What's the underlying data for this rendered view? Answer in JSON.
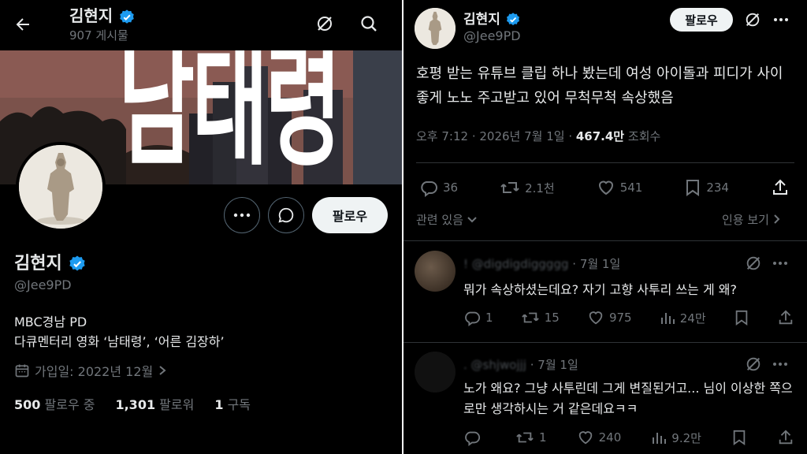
{
  "colors": {
    "background": "#000000",
    "text": "#e7e9ea",
    "muted": "#71767b",
    "verified": "#1d9bf0",
    "follow_button": "#eff3f4"
  },
  "left": {
    "header": {
      "name": "김현지",
      "posts": "907 게시물"
    },
    "banner": {
      "title": "남태령"
    },
    "profile": {
      "name": "김현지",
      "handle": "@Jee9PD",
      "bio_line1": "MBC경남 PD",
      "bio_line2": "다큐멘터리 영화 ‘남태령’, ‘어른 김장하’",
      "joined": "가입일: 2022년 12월",
      "following_count": "500",
      "following_label": "팔로우 중",
      "followers_count": "1,301",
      "followers_label": "팔로워",
      "subs_count": "1",
      "subs_label": "구독",
      "follow_label": "팔로우"
    },
    "icons": [
      "back-arrow-icon",
      "grok-icon",
      "search-icon",
      "more-icon",
      "message-icon",
      "verified-icon",
      "calendar-icon"
    ]
  },
  "right": {
    "author": {
      "name": "김현지",
      "handle": "@Jee9PD",
      "follow_label": "팔로우"
    },
    "tweet": {
      "text": "호평 받는 유튜브 클립 하나 봤는데 여성 아이돌과 피디가 사이좋게 노노 주고받고 있어 무척무척 속상했음",
      "time": "오후 7:12 · 2026년 7월 1일 · ",
      "views": "467.4만",
      "views_label": "조회수",
      "replies": "36",
      "retweets": "2.1천",
      "likes": "541",
      "bookmarks": "234",
      "related": "관련 있음",
      "quote": "인용 보기"
    },
    "replies": [
      {
        "handle": "! @digdigdiggggg",
        "date": "· 7월 1일",
        "text": "뭐가 속상하셨는데요? 자기 고향 사투리 쓰는 게 왜?",
        "replies": "1",
        "retweets": "15",
        "likes": "975",
        "views": "24만"
      },
      {
        "handle": ". @shjwojjj",
        "date": "· 7월 1일",
        "text": "노가 왜요? 그냥 사투린데 그게 변질된거고... 님이 이상한 쪽으로만 생각하시는 거 같은데요ㅋㅋ",
        "replies": "",
        "retweets": "1",
        "likes": "240",
        "views": "9.2만"
      }
    ]
  }
}
